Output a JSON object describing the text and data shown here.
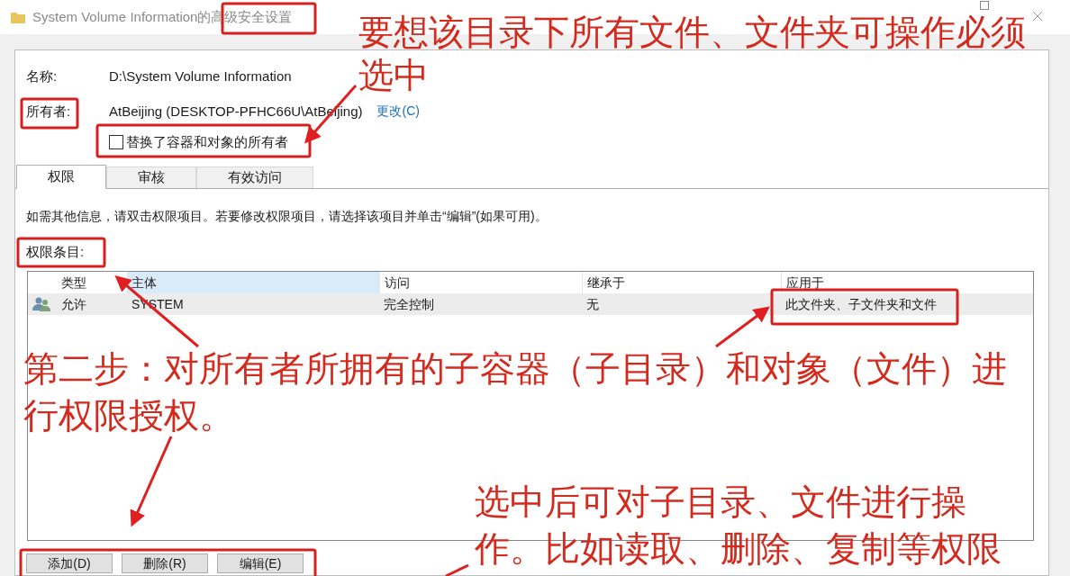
{
  "window": {
    "title": "System Volume Information的高级安全设置"
  },
  "fields": [
    {
      "label": "名称:",
      "value": "D:\\System Volume Information"
    },
    {
      "label": "所有者:",
      "value": "AtBeijing (DESKTOP-PFHC66U\\AtBeijing)",
      "link": "更改(C)"
    }
  ],
  "checkbox": {
    "label": "替换了容器和对象的所有者",
    "checked": false
  },
  "tabs": [
    {
      "label": "权限",
      "selected": true
    },
    {
      "label": "审核",
      "selected": false
    },
    {
      "label": "有效访问",
      "selected": false
    }
  ],
  "info": "如需其他信息，请双击权限项目。若要修改权限项目，请选择该项目并单击“编辑”(如果可用)。",
  "list_label": "权限条目:",
  "table": {
    "columns": [
      {
        "label": "类型",
        "highlighted": false
      },
      {
        "label": "主体",
        "highlighted": true
      },
      {
        "label": "访问",
        "highlighted": false
      },
      {
        "label": "继承于",
        "highlighted": false
      },
      {
        "label": "应用于",
        "highlighted": false
      }
    ],
    "rows": [
      {
        "selected": true,
        "cells": [
          "允许",
          "SYSTEM",
          "完全控制",
          "无",
          "此文件夹、子文件夹和文件"
        ]
      }
    ]
  },
  "buttons": [
    "添加(D)",
    "删除(R)",
    "编辑(E)"
  ],
  "annotations": [
    {
      "lines": [
        "要想该目录下所有文件、文件夹可操作必须",
        "选中"
      ]
    },
    {
      "lines": [
        "第二步：对所有者所拥有的子容器（子目录）和对象（文件）进",
        "行权限授权。"
      ]
    },
    {
      "lines": [
        "选中后可对子目录、文件进行操",
        "作。比如读取、删除、复制等权限"
      ]
    }
  ]
}
